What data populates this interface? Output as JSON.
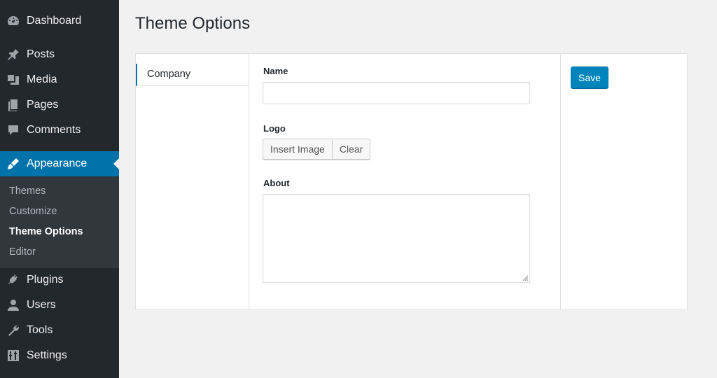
{
  "sidebar": {
    "items": [
      {
        "label": "Dashboard",
        "icon": "dashboard-icon"
      },
      {
        "label": "Posts",
        "icon": "pin-icon"
      },
      {
        "label": "Media",
        "icon": "media-icon"
      },
      {
        "label": "Pages",
        "icon": "pages-icon"
      },
      {
        "label": "Comments",
        "icon": "comment-icon"
      },
      {
        "label": "Appearance",
        "icon": "brush-icon"
      },
      {
        "label": "Plugins",
        "icon": "plugin-icon"
      },
      {
        "label": "Users",
        "icon": "user-icon"
      },
      {
        "label": "Tools",
        "icon": "wrench-icon"
      },
      {
        "label": "Settings",
        "icon": "sliders-icon"
      }
    ],
    "submenu": [
      "Themes",
      "Customize",
      "Theme Options",
      "Editor"
    ],
    "active_item": "Appearance",
    "current_subitem": "Theme Options"
  },
  "page": {
    "title": "Theme Options"
  },
  "tabs": [
    "Company"
  ],
  "form": {
    "name_label": "Name",
    "name_value": "",
    "logo_label": "Logo",
    "insert_image_label": "Insert Image",
    "clear_label": "Clear",
    "about_label": "About",
    "about_value": ""
  },
  "actions": {
    "save_label": "Save"
  },
  "colors": {
    "sidebar_bg": "#23282d",
    "submenu_bg": "#32373c",
    "accent": "#0073aa",
    "save_button": "#0085ba",
    "page_bg": "#f1f1f1"
  }
}
